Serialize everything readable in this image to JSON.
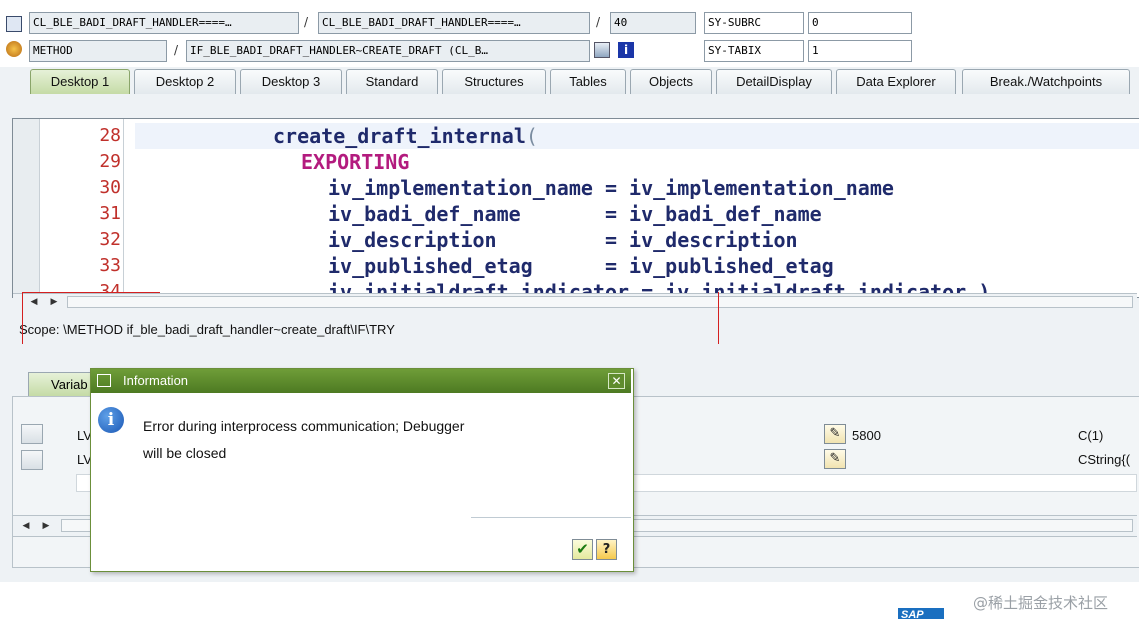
{
  "header": {
    "row1": {
      "program": "CL_BLE_BADI_DRAFT_HANDLER====…",
      "include": "CL_BLE_BADI_DRAFT_HANDLER====…",
      "line": "40",
      "sysfield_label": "SY-SUBRC",
      "sysfield_value": "0",
      "sep": "/"
    },
    "row2": {
      "event_type": "METHOD",
      "event_name": "IF_BLE_BADI_DRAFT_HANDLER~CREATE_DRAFT (CL_B…",
      "sysfield_label": "SY-TABIX",
      "sysfield_value": "1",
      "sep": "/"
    }
  },
  "tabs": [
    {
      "label": "Desktop 1",
      "active": true
    },
    {
      "label": "Desktop 2"
    },
    {
      "label": "Desktop 3"
    },
    {
      "label": "Standard"
    },
    {
      "label": "Structures"
    },
    {
      "label": "Tables"
    },
    {
      "label": "Objects"
    },
    {
      "label": "DetailDisplay"
    },
    {
      "label": "Data Explorer"
    },
    {
      "label": "Break./Watchpoints"
    }
  ],
  "code": {
    "lines": [
      {
        "num": "28",
        "text": "create_draft_internal",
        "paren": "("
      },
      {
        "num": "29",
        "text": "EXPORTING"
      },
      {
        "num": "30",
        "text": "iv_implementation_name = iv_implementation_name"
      },
      {
        "num": "31",
        "text": "iv_badi_def_name       = iv_badi_def_name"
      },
      {
        "num": "32",
        "text": "iv_description         = iv_description"
      },
      {
        "num": "33",
        "text": "iv_published_etag      = iv_published_etag"
      },
      {
        "num": "34",
        "text": "iv_initialdraft_indicator = iv_initialdraft_indicator )"
      }
    ]
  },
  "scope": "Scope: \\METHOD if_ble_badi_draft_handler~create_draft\\IF\\TRY",
  "variables": {
    "tab_label": "Variab",
    "rows": [
      {
        "name": "LV",
        "value": "5800",
        "type": "C(1)"
      },
      {
        "name": "LV",
        "value": "",
        "type": "CString{("
      }
    ]
  },
  "dialog": {
    "title": "Information",
    "message_line1": "Error during interprocess communication; Debugger",
    "message_line2": "will be closed",
    "close_glyph": "✕"
  },
  "watermark": "@稀土掘金技术社区",
  "brand": "SAP",
  "colors": {
    "tab_active": "#c5dba6",
    "dialog_title": "#4d7a22",
    "line_numbers": "#c0302b",
    "code_text": "#1f2a6b",
    "keyword": "#b31b7e",
    "red_markers": "#d42020"
  }
}
